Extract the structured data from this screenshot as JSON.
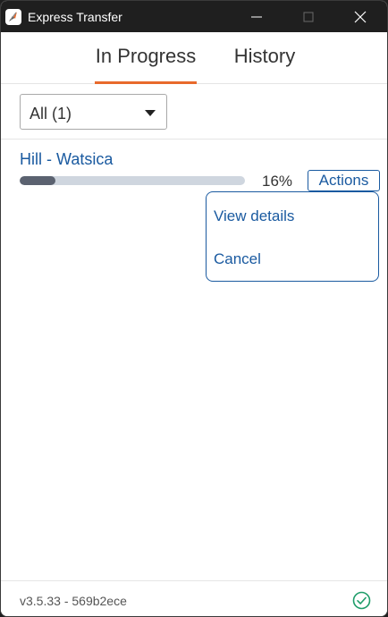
{
  "window": {
    "title": "Express Transfer",
    "icon": "rocket-icon",
    "controls": [
      "minimize-icon",
      "maximize-icon",
      "close-icon"
    ]
  },
  "tabs": [
    {
      "label": "In Progress",
      "active": true
    },
    {
      "label": "History",
      "active": false
    }
  ],
  "filter": {
    "selected": "All (1)"
  },
  "transfers": [
    {
      "name": "Hill - Watsica",
      "progress_percent": 16,
      "progress_text": "16%",
      "actions_label": "Actions"
    }
  ],
  "actions_menu": {
    "items": [
      "View details",
      "Cancel"
    ]
  },
  "footer": {
    "version": "v3.5.33 - 569b2ece",
    "status_icon": "check-circle-icon"
  },
  "colors": {
    "accent_orange": "#e86a2c",
    "link_blue": "#1a5aa0",
    "progress_fill": "#5b6270",
    "progress_track": "#cfd6df",
    "status_green": "#1f9d6a",
    "titlebar": "#1f1f1f"
  }
}
